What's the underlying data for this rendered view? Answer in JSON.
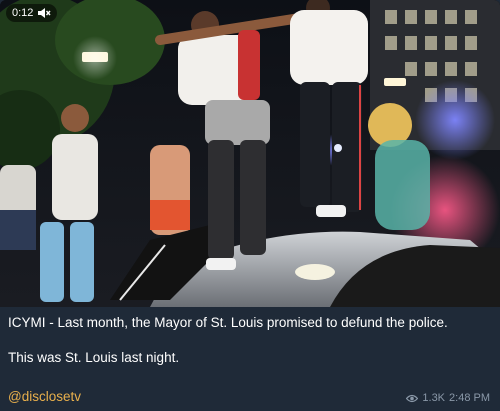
{
  "video": {
    "duration": "0:12",
    "mute_icon": "speaker-muted-icon"
  },
  "caption": {
    "line1": "ICYMI - Last month, the Mayor of St. Louis promised to defund the police.",
    "line2": "This was St. Louis last night."
  },
  "channel": {
    "handle": "@disclosetv"
  },
  "meta": {
    "eye_icon": "eye-icon",
    "views": "1.3K",
    "time": "2:48 PM"
  },
  "colors": {
    "background": "#1f2a38",
    "link": "#e9b04c",
    "meta": "#8a98a8"
  }
}
